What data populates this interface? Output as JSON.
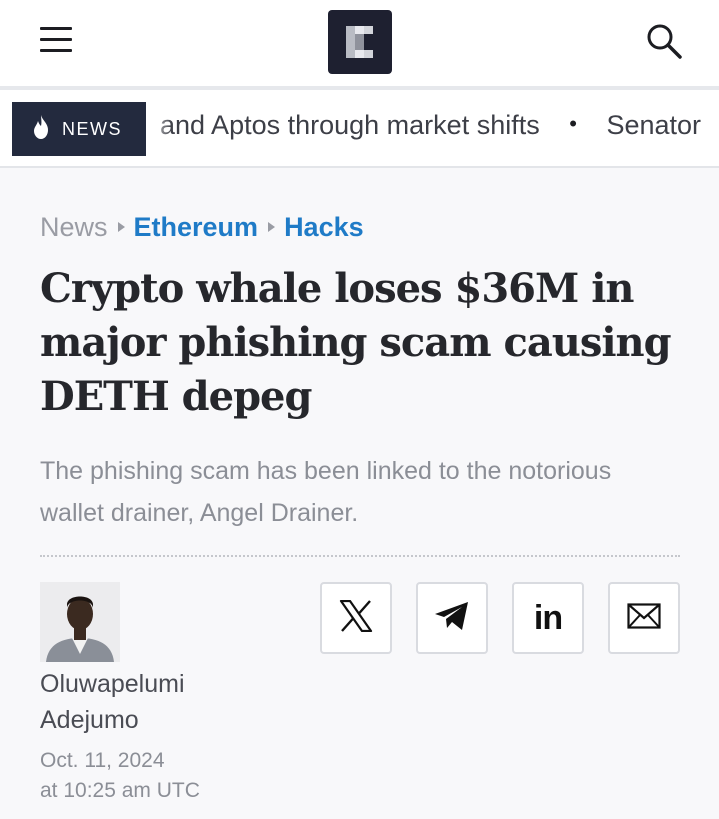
{
  "header": {
    "menu_icon": "hamburger-menu-icon",
    "logo_icon": "site-logo",
    "search_icon": "search-icon"
  },
  "ticker": {
    "badge_label": "NEWS",
    "badge_icon": "flame-icon",
    "items": [
      "and Aptos through market shifts",
      "Senator"
    ],
    "separator": "•"
  },
  "breadcrumb": {
    "items": [
      "News",
      "Ethereum",
      "Hacks"
    ]
  },
  "article": {
    "title": "Crypto whale loses $36M in major phishing scam causing DETH depeg",
    "subtitle": "The phishing scam has been linked to the notorious wallet drainer, Angel Drainer.",
    "author_first": "Oluwapelumi",
    "author_last": "Adejumo",
    "date": "Oct. 11, 2024",
    "time": "at 10:25 am UTC"
  },
  "share": {
    "icons": [
      "x-icon",
      "telegram-icon",
      "linkedin-icon",
      "email-icon"
    ],
    "linkedin_text": "in"
  },
  "colors": {
    "link": "#1f7bc7",
    "badge_bg": "#232a3e",
    "logo_bg": "#1e2030",
    "headline": "#26272c",
    "muted": "#8b8e96"
  }
}
